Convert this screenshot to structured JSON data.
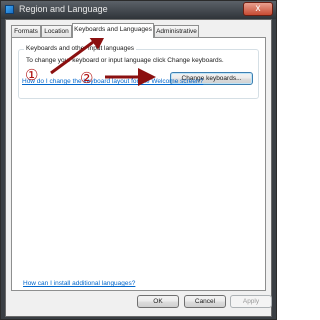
{
  "window": {
    "title": "Region and Language",
    "close_label": "x"
  },
  "tabs": [
    {
      "label": "Formats"
    },
    {
      "label": "Location"
    },
    {
      "label": "Keyboards and Languages",
      "active": true
    },
    {
      "label": "Administrative"
    }
  ],
  "keyboards_group": {
    "legend": "Keyboards and other input languages",
    "description": "To change your keyboard or input language click Change keyboards.",
    "change_button": "Change keyboards...",
    "welcome_link": "How do I change the keyboard layout for the Welcome screen?"
  },
  "install_link": "How can I install additional languages?",
  "footer": {
    "ok": "OK",
    "cancel": "Cancel",
    "apply": "Apply"
  },
  "annotations": {
    "marker_1": "①",
    "marker_2": "②",
    "arrow_color": "#8b1010"
  }
}
